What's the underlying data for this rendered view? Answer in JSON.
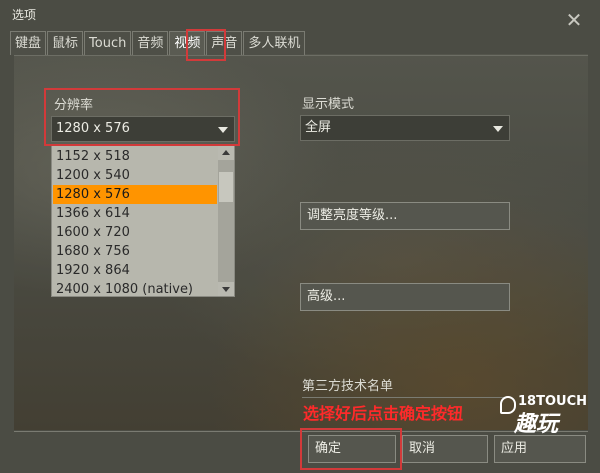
{
  "window": {
    "title": "选项",
    "close_glyph": "✕"
  },
  "tabs": [
    "键盘",
    "鼠标",
    "Touch",
    "音频",
    "视频",
    "声音",
    "多人联机"
  ],
  "resolution": {
    "label": "分辨率",
    "selected": "1280 x 576",
    "options": [
      "1152 x 518",
      "1200 x 540",
      "1280 x 576",
      "1366 x 614",
      "1600 x 720",
      "1680 x 756",
      "1920 x 864",
      "2400 x 1080 (native)"
    ]
  },
  "display_mode": {
    "label": "显示模式",
    "selected": "全屏"
  },
  "buttons": {
    "brightness": "调整亮度等级...",
    "advanced": "高级...",
    "third_party": "第三方技术名单",
    "ok": "确定",
    "cancel": "取消",
    "apply": "应用"
  },
  "annotation": "选择好后点击确定按钮",
  "watermark": {
    "line1": "18TOUCH",
    "line2": "趣玩"
  },
  "colors": {
    "highlight": "#d23a3a",
    "selected_item": "#ff9400",
    "annotation": "#ff2a2a"
  }
}
